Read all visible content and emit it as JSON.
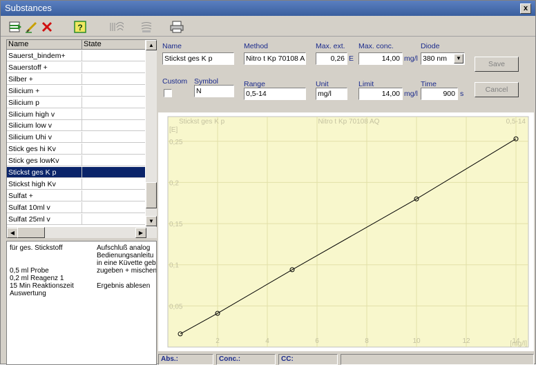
{
  "window": {
    "title": "Substances",
    "close_glyph": "x"
  },
  "toolbar": {
    "icons": [
      "add-icon",
      "edit-icon",
      "delete-icon",
      "help-icon",
      "signal-icon",
      "sound-icon",
      "print-icon"
    ]
  },
  "list": {
    "headers": [
      "Name",
      "State"
    ],
    "rows": [
      {
        "name": "Sauerst_bindem+",
        "state": ""
      },
      {
        "name": "Sauerstoff   +",
        "state": ""
      },
      {
        "name": "Silber      +",
        "state": ""
      },
      {
        "name": "Silicium     +",
        "state": ""
      },
      {
        "name": "Silicium      p",
        "state": ""
      },
      {
        "name": "Silicium high v",
        "state": ""
      },
      {
        "name": "Silicium low  v",
        "state": ""
      },
      {
        "name": "Silicium Uhi v",
        "state": ""
      },
      {
        "name": "Stick ges hi Kv",
        "state": ""
      },
      {
        "name": "Stick ges lowKv",
        "state": ""
      },
      {
        "name": "Stickst ges K p",
        "state": "",
        "selected": true
      },
      {
        "name": "Stickst high Kv",
        "state": ""
      },
      {
        "name": "Sulfat     +",
        "state": ""
      },
      {
        "name": "Sulfat 10ml  v",
        "state": ""
      },
      {
        "name": "Sulfat 25ml  v",
        "state": ""
      }
    ]
  },
  "description": {
    "left": "für ges. Stickstoff\n\n\n0,5 ml Probe\n0,2 ml Reagenz 1\n15 Min Reaktionszeit\nAuswertung",
    "right": "Aufschluß analog\nBedienungsanleitu\nin eine Küvette geb\nzugeben + mischen\n\nErgebnis ablesen"
  },
  "form": {
    "labels": {
      "name": "Name",
      "method": "Method",
      "max_ext": "Max. ext.",
      "max_conc": "Max. conc.",
      "diode": "Diode",
      "custom": "Custom",
      "symbol": "Symbol",
      "range": "Range",
      "unit": "Unit",
      "limit": "Limit",
      "time": "Time"
    },
    "values": {
      "name": "Stickst ges K p",
      "method": "Nitro t Kp 70108 A",
      "max_ext": "0,26",
      "max_conc": "14,00",
      "diode": "380 nm",
      "symbol": "N",
      "range": "0,5-14",
      "unit": "mg/l",
      "limit": "14,00",
      "time": "900"
    },
    "units": {
      "max_ext": "E",
      "max_conc": "mg/l",
      "limit": "mg/l",
      "time": "s"
    },
    "buttons": {
      "save": "Save",
      "cancel": "Cancel"
    }
  },
  "chart_data": {
    "type": "line",
    "title": "Stickst ges K p",
    "subtitle": "Nitro t Kp 70108 AQ",
    "range_label": "0,5-14",
    "ylabel": "[E]",
    "xlabel": "[mg/l]",
    "xlim": [
      0,
      14.5
    ],
    "ylim": [
      0,
      0.28
    ],
    "xticks": [
      2,
      4,
      6,
      8,
      10,
      12,
      14
    ],
    "yticks": [
      0.05,
      0.1,
      0.15,
      0.2,
      0.25
    ],
    "xtick_labels": [
      "2",
      "4",
      "6",
      "8",
      "10",
      "12",
      "14"
    ],
    "ytick_labels": [
      "0,05",
      "0,1",
      "0,15",
      "0,2",
      "0,25"
    ],
    "x": [
      0.5,
      2,
      5,
      10,
      14
    ],
    "y": [
      0.016,
      0.041,
      0.094,
      0.18,
      0.253
    ],
    "grid": true,
    "colors": {
      "background": "#f8f7cc",
      "grid": "#e2e0a8",
      "line": "#000000",
      "text": "#c4c2a0"
    }
  },
  "status": {
    "abs": "Abs.:",
    "conc": "Conc.:",
    "cc": "CC:"
  }
}
